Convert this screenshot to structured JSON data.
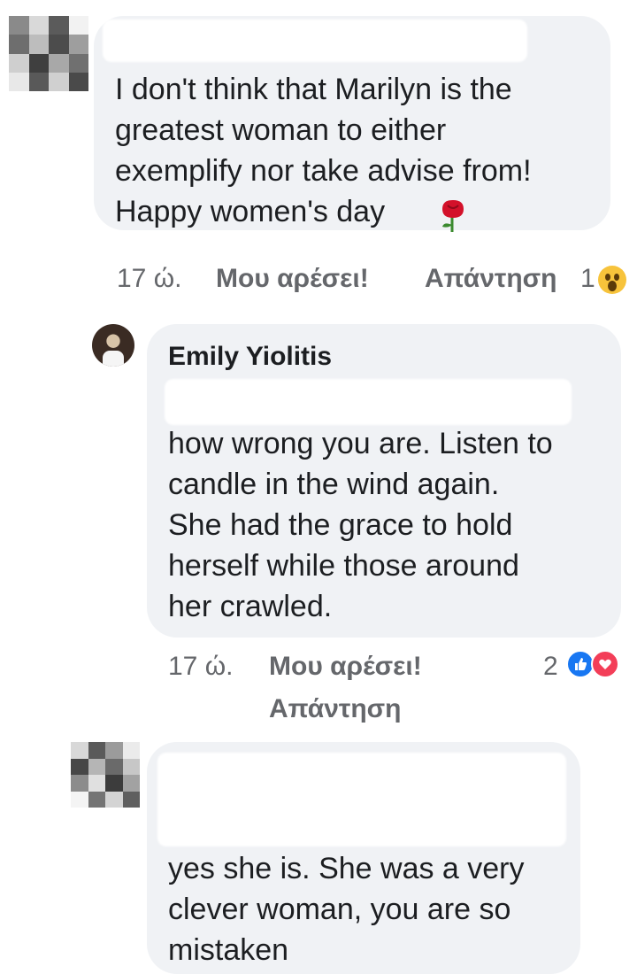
{
  "comments": [
    {
      "text": "I don't think that Marilyn is the\ngreatest woman to either\nexemplify nor take advise from!\nHappy women's day",
      "emoji": "rose",
      "time": "17 ώ.",
      "like_label": "Μου αρέσει!",
      "reply_label": "Απάντηση",
      "reaction_count": "1",
      "reaction_icon": "wow-emoji-icon"
    },
    {
      "author": "Emily Yiolitis",
      "text": "how wrong you are. Listen to\ncandle in the wind again.\nShe had the grace to hold\nherself while those around\nher crawled.",
      "time": "17 ώ.",
      "like_label": "Μου αρέσει!",
      "reply_label": "Απάντηση",
      "reaction_count": "2",
      "reaction_icons": [
        "like-reaction-icon",
        "love-reaction-icon"
      ]
    },
    {
      "text": "yes she is. She was a very\nclever woman, you are so\nmistaken"
    }
  ],
  "colors": {
    "bubble": "#f0f2f5",
    "meta_text": "#65676b",
    "like_blue": "#1877f2",
    "love_red": "#f33e58"
  }
}
